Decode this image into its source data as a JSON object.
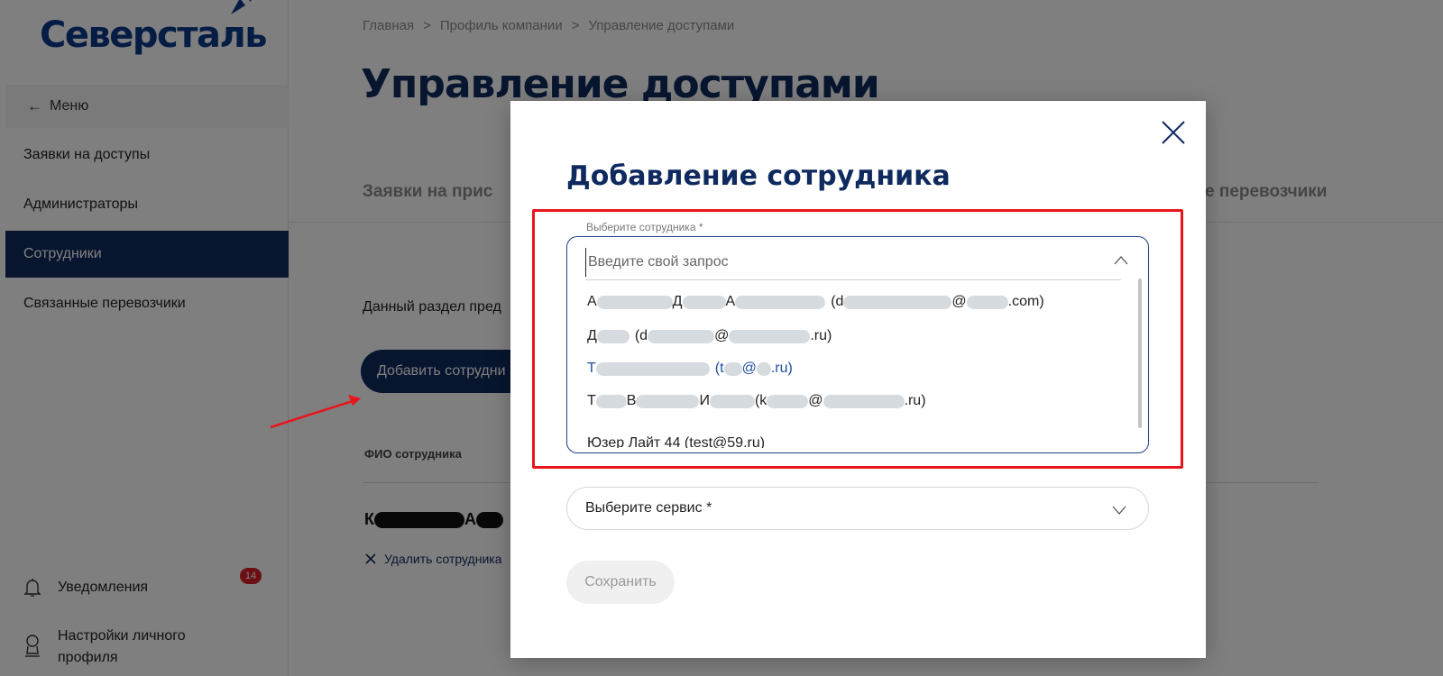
{
  "sidebar": {
    "logo": "Северсталь",
    "back_label": "Меню",
    "items": [
      {
        "label": "Заявки на доступы"
      },
      {
        "label": "Администраторы"
      },
      {
        "label": "Сотрудники"
      },
      {
        "label": "Связанные перевозчики"
      }
    ],
    "active_index": 2,
    "notifications": {
      "label": "Уведомления",
      "count": "14"
    },
    "profile_settings": {
      "line1": "Настройки личного",
      "line2": "профиля"
    }
  },
  "breadcrumb": [
    "Главная",
    "Профиль компании",
    "Управление доступами"
  ],
  "page": {
    "title": "Управление доступами",
    "tab_left_visible": "Заявки на прис",
    "tab_right_visible": "е перевозчики",
    "description_visible": "Данный раздел пред",
    "add_button_visible": "Добавить сотрудни",
    "column_header": "ФИО сотрудника",
    "employee_name": {
      "first": "К",
      "second": "А"
    },
    "delete_link_visible": "Удалить сотрудника"
  },
  "modal": {
    "title": "Добавление сотрудника",
    "employee_field": {
      "label": "Выберите сотрудника *",
      "placeholder": "Введите свой запрос",
      "options": [
        {
          "parts": [
            "А",
            "Д",
            "А",
            "(d",
            "@",
            ".com)"
          ]
        },
        {
          "parts": [
            "Д",
            "(d",
            "@",
            ".ru)"
          ]
        },
        {
          "parts": [
            "Т",
            "(t",
            "@",
            ".ru)"
          ],
          "highlighted": true
        },
        {
          "parts": [
            "Т",
            "В",
            "И",
            "(k",
            "@",
            ".ru)"
          ]
        },
        {
          "text": "Юзер Лайт 44 (test@59.ru)"
        }
      ]
    },
    "service_field": {
      "placeholder": "Выберите сервис *"
    },
    "save_label": "Сохранить"
  },
  "colors": {
    "brand_navy": "#0e2a5e",
    "logo_blue": "#0a3a8a",
    "highlight_red": "#e8161c",
    "badge_red": "#d81e28",
    "option_highlight": "#1e4ea3"
  }
}
